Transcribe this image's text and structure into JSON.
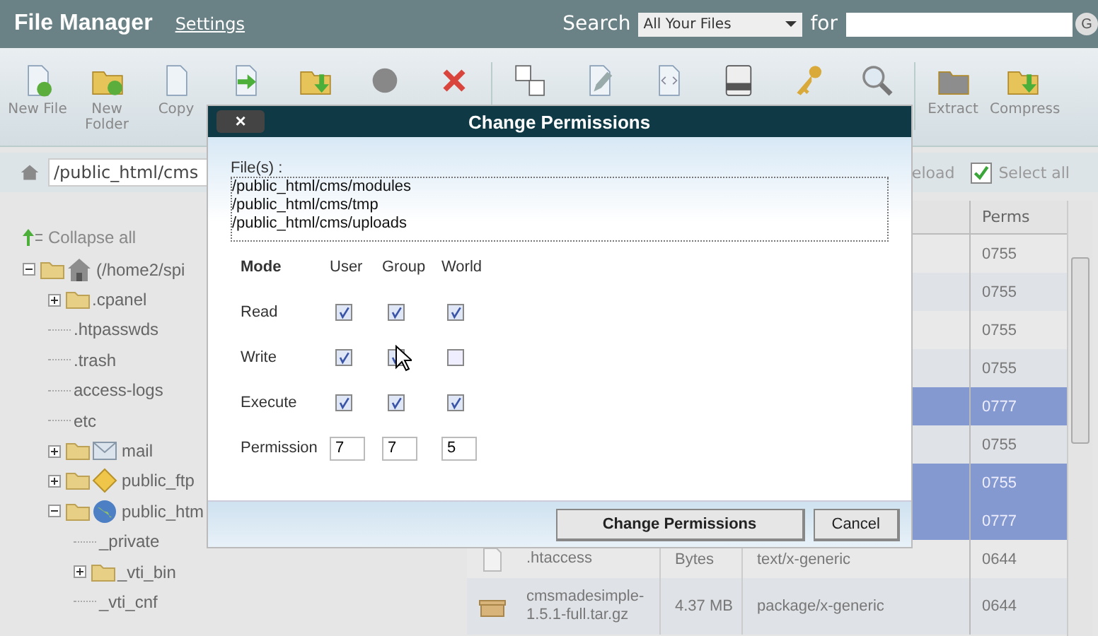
{
  "header": {
    "title": "File Manager",
    "settings_link": "Settings",
    "search_label": "Search",
    "search_scope": "All Your Files",
    "for_label": "for",
    "go_button": "G"
  },
  "toolbar": {
    "items": [
      {
        "kind": "new-file",
        "label": "New File"
      },
      {
        "kind": "new-folder",
        "label": "New Folder"
      },
      {
        "kind": "copy",
        "label": "Copy"
      },
      {
        "kind": "move"
      },
      {
        "kind": "upload"
      },
      {
        "kind": "ball"
      },
      {
        "kind": "delete"
      },
      {
        "kind": "divider"
      },
      {
        "kind": "rename"
      },
      {
        "kind": "edit"
      },
      {
        "kind": "code"
      },
      {
        "kind": "html"
      },
      {
        "kind": "key"
      },
      {
        "kind": "search"
      },
      {
        "kind": "divider"
      },
      {
        "kind": "extract",
        "label": "Extract"
      },
      {
        "kind": "compress",
        "label": "Compress"
      }
    ]
  },
  "path_bar": {
    "value": "/public_html/cms"
  },
  "tree": {
    "collapse_all": "Collapse all",
    "items": [
      {
        "label": "(/home2/spi",
        "kind": "home",
        "expanded": true,
        "children": [
          {
            "label": ".cpanel",
            "kind": "folder",
            "expanded": false
          },
          {
            "label": ".htpasswds",
            "kind": "file"
          },
          {
            "label": ".trash",
            "kind": "file"
          },
          {
            "label": "access-logs",
            "kind": "file"
          },
          {
            "label": "etc",
            "kind": "file"
          },
          {
            "label": "mail",
            "kind": "mail",
            "expanded": false
          },
          {
            "label": "public_ftp",
            "kind": "ftp",
            "expanded": false
          },
          {
            "label": "public_htm",
            "kind": "web",
            "expanded": true,
            "children": [
              {
                "label": "_private",
                "kind": "file"
              },
              {
                "label": "_vti_bin",
                "kind": "folder",
                "expanded": false
              },
              {
                "label": "_vti_cnf",
                "kind": "file"
              }
            ]
          }
        ]
      }
    ]
  },
  "file_list": {
    "reload": "eload",
    "select_all": {
      "label": "Select all",
      "checked": true
    },
    "perms_header": "Perms",
    "rows": [
      {
        "perms": "0755",
        "selected": false
      },
      {
        "perms": "0755",
        "selected": false
      },
      {
        "perms": "0755",
        "selected": false
      },
      {
        "perms": "0755",
        "selected": false
      },
      {
        "perms": "0777",
        "selected": true
      },
      {
        "perms": "0755",
        "selected": false
      },
      {
        "perms": "0755",
        "selected": true
      },
      {
        "perms": "0777",
        "selected": true
      },
      {
        "kind": "file",
        "name": ".htaccess",
        "size": "Bytes",
        "type": "text/x-generic",
        "perms": "0644",
        "selected": false
      },
      {
        "kind": "package",
        "name": "cmsmadesimple-1.5.1-full.tar.gz",
        "size": "4.37 MB",
        "type": "package/x-generic",
        "perms": "0644",
        "selected": false
      }
    ]
  },
  "dialog": {
    "title": "Change Permissions",
    "close": "×",
    "files_label": "File(s) :",
    "files": [
      "/public_html/cms/modules",
      "/public_html/cms/tmp",
      "/public_html/cms/uploads"
    ],
    "columns": [
      "Mode",
      "User",
      "Group",
      "World"
    ],
    "rows": [
      {
        "label": "Read",
        "checked": [
          true,
          true,
          true
        ]
      },
      {
        "label": "Write",
        "checked": [
          true,
          true,
          false
        ]
      },
      {
        "label": "Execute",
        "checked": [
          true,
          true,
          true
        ]
      }
    ],
    "permission": {
      "label": "Permission",
      "values": [
        "7",
        "7",
        "5"
      ]
    },
    "buttons": [
      {
        "kind": "primary",
        "label": "Change Permissions"
      },
      {
        "kind": "secondary",
        "label": "Cancel"
      }
    ]
  }
}
